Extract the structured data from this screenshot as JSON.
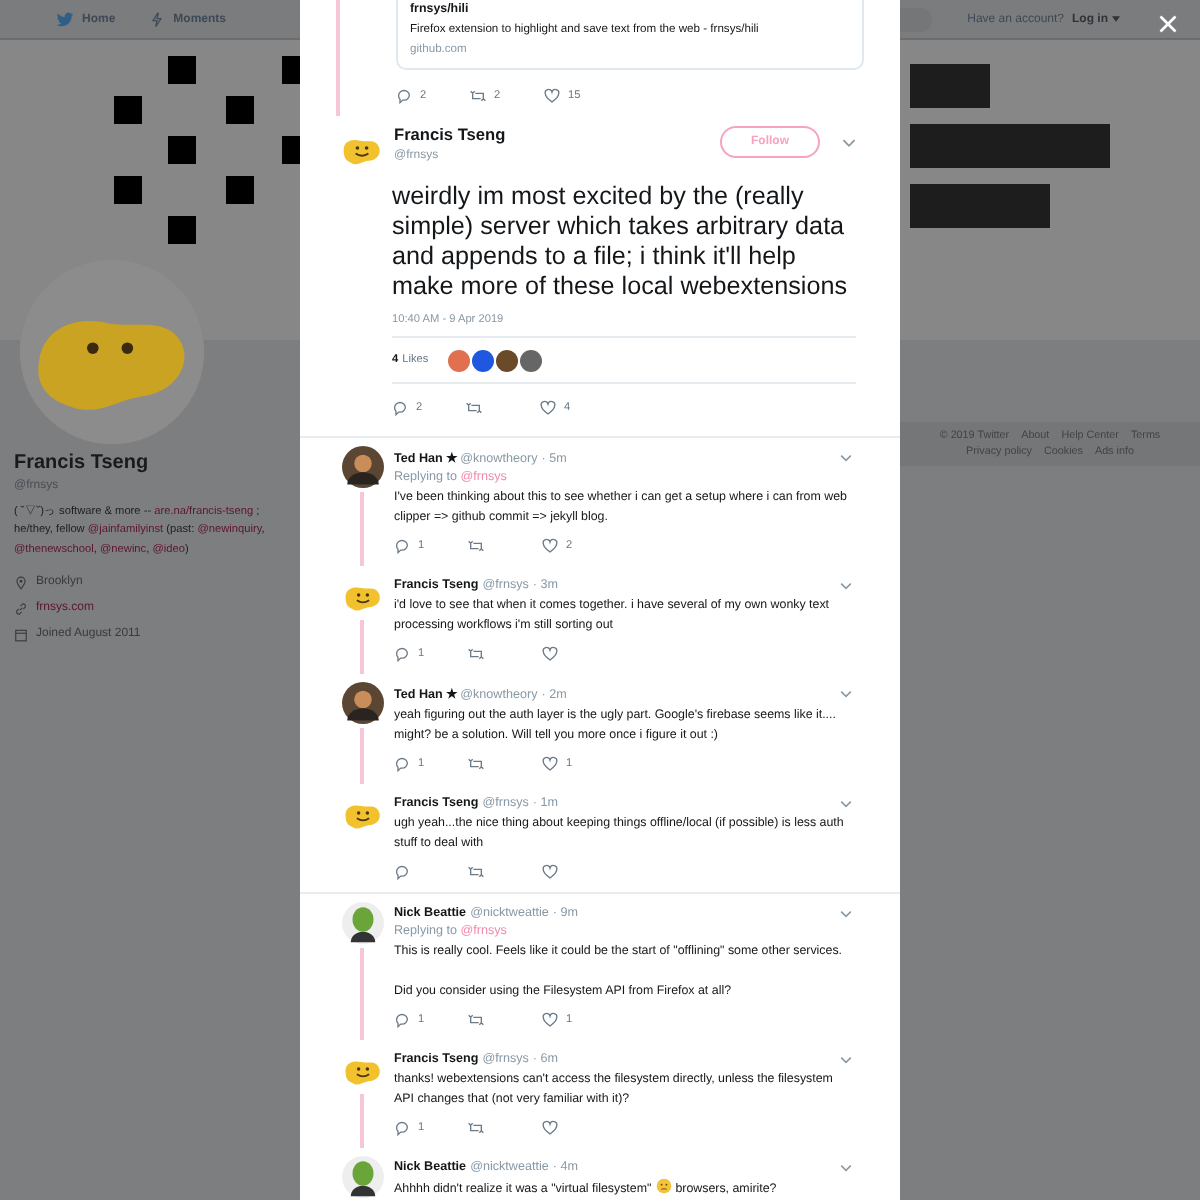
{
  "nav": {
    "links": [
      {
        "label": "Home"
      },
      {
        "label": "Moments"
      }
    ],
    "login_prompt": "Have an account?",
    "login": "Log in"
  },
  "profile": {
    "name": "Francis Tseng",
    "handle": "@frnsys",
    "bio": [
      {
        "kind": "plain",
        "text": "( ˘▽˘)っ software & more -- "
      },
      {
        "kind": "link",
        "text": "are.na/francis-tseng"
      },
      {
        "kind": "plain",
        "text": " ; he/they, fellow "
      },
      {
        "kind": "link",
        "text": "@jainfamilyinst"
      },
      {
        "kind": "plain",
        "text": " (past: "
      },
      {
        "kind": "link",
        "text": "@newinquiry"
      },
      {
        "kind": "plain",
        "text": ", "
      },
      {
        "kind": "link",
        "text": "@thenewschool"
      },
      {
        "kind": "plain",
        "text": ", "
      },
      {
        "kind": "link",
        "text": "@newinc"
      },
      {
        "kind": "plain",
        "text": ", "
      },
      {
        "kind": "link",
        "text": "@ideo"
      },
      {
        "kind": "plain",
        "text": ")"
      }
    ],
    "location": "Brooklyn",
    "website": "frnsys.com",
    "joined": "Joined August 2011"
  },
  "footer": [
    "© 2019 Twitter",
    "About",
    "Help Center",
    "Terms",
    "Privacy policy",
    "Cookies",
    "Ads info"
  ],
  "quoted_card": {
    "title": "frnsys/hili",
    "description": "Firefox extension to highlight and save text from the web - frnsys/hili",
    "domain": "github.com",
    "replies": "2",
    "retweets": "2",
    "likes": "15"
  },
  "tweet": {
    "kind": "emoji",
    "name": "Francis Tseng",
    "handle": "@frnsys",
    "follow": "Follow",
    "text": "weirdly im most excited by the (really simple) server which takes arbitrary data and appends to a file; i think it'll help make more of these local webextensions",
    "timestamp": "10:40 AM - 9 Apr 2019",
    "likes_count": "4",
    "likes_label": "Likes",
    "likers": [
      {
        "color": "#e0704f"
      },
      {
        "color": "#1f57e0"
      },
      {
        "color": "#6b4a2a"
      },
      {
        "color": "#666666"
      }
    ],
    "replies": "2",
    "likes": "4"
  },
  "threads": [
    {
      "replies": [
        {
          "kind": "person",
          "name": "Ted Han ★",
          "handle": "@knowtheory",
          "time": "· 5m",
          "replying_prefix": "Replying to",
          "replying_to": "@frnsys",
          "text": [
            "I've been thinking about this to see whether i can get a setup where i can from web clipper => github commit => jekyll blog."
          ],
          "replies": "1",
          "likes": "2"
        },
        {
          "kind": "emoji",
          "name": "Francis Tseng",
          "handle": "@frnsys",
          "time": "· 3m",
          "text": [
            "i'd love to see that when it comes together. i have several of my own wonky text processing workflows i'm still sorting out"
          ],
          "replies": "1"
        },
        {
          "kind": "person",
          "name": "Ted Han ★",
          "handle": "@knowtheory",
          "time": "· 2m",
          "text": [
            "yeah figuring out the auth layer is the ugly part.  Google's firebase seems like it.... might? be a solution.  Will tell you more once i figure it out :)"
          ],
          "replies": "1",
          "likes": "1"
        },
        {
          "kind": "emoji",
          "name": "Francis Tseng",
          "handle": "@frnsys",
          "time": "· 1m",
          "text": [
            "ugh yeah...the nice thing about keeping things offline/local (if possible) is less auth stuff to deal with"
          ]
        }
      ]
    },
    {
      "replies": [
        {
          "kind": "alien",
          "name": "Nick Beattie",
          "handle": "@nicktweattie",
          "time": "· 9m",
          "replying_prefix": "Replying to",
          "replying_to": "@frnsys",
          "text": [
            "This is really cool. Feels like it could be the start of \"offlining\" some other services.\n\nDid you consider using the Filesystem API from Firefox at all?"
          ],
          "replies": "1",
          "likes": "1"
        },
        {
          "kind": "emoji",
          "name": "Francis Tseng",
          "handle": "@frnsys",
          "time": "· 6m",
          "text": [
            "thanks! webextensions can't access the filesystem directly, unless the filesystem API changes that (not very familiar with it)?"
          ],
          "replies": "1"
        },
        {
          "kind": "alien",
          "name": "Nick Beattie",
          "handle": "@nicktweattie",
          "time": "· 4m",
          "text": [
            "Ahhhh didn't realize it was a \"virtual filesystem\"",
            "browsers, amirite?"
          ]
        }
      ]
    }
  ]
}
